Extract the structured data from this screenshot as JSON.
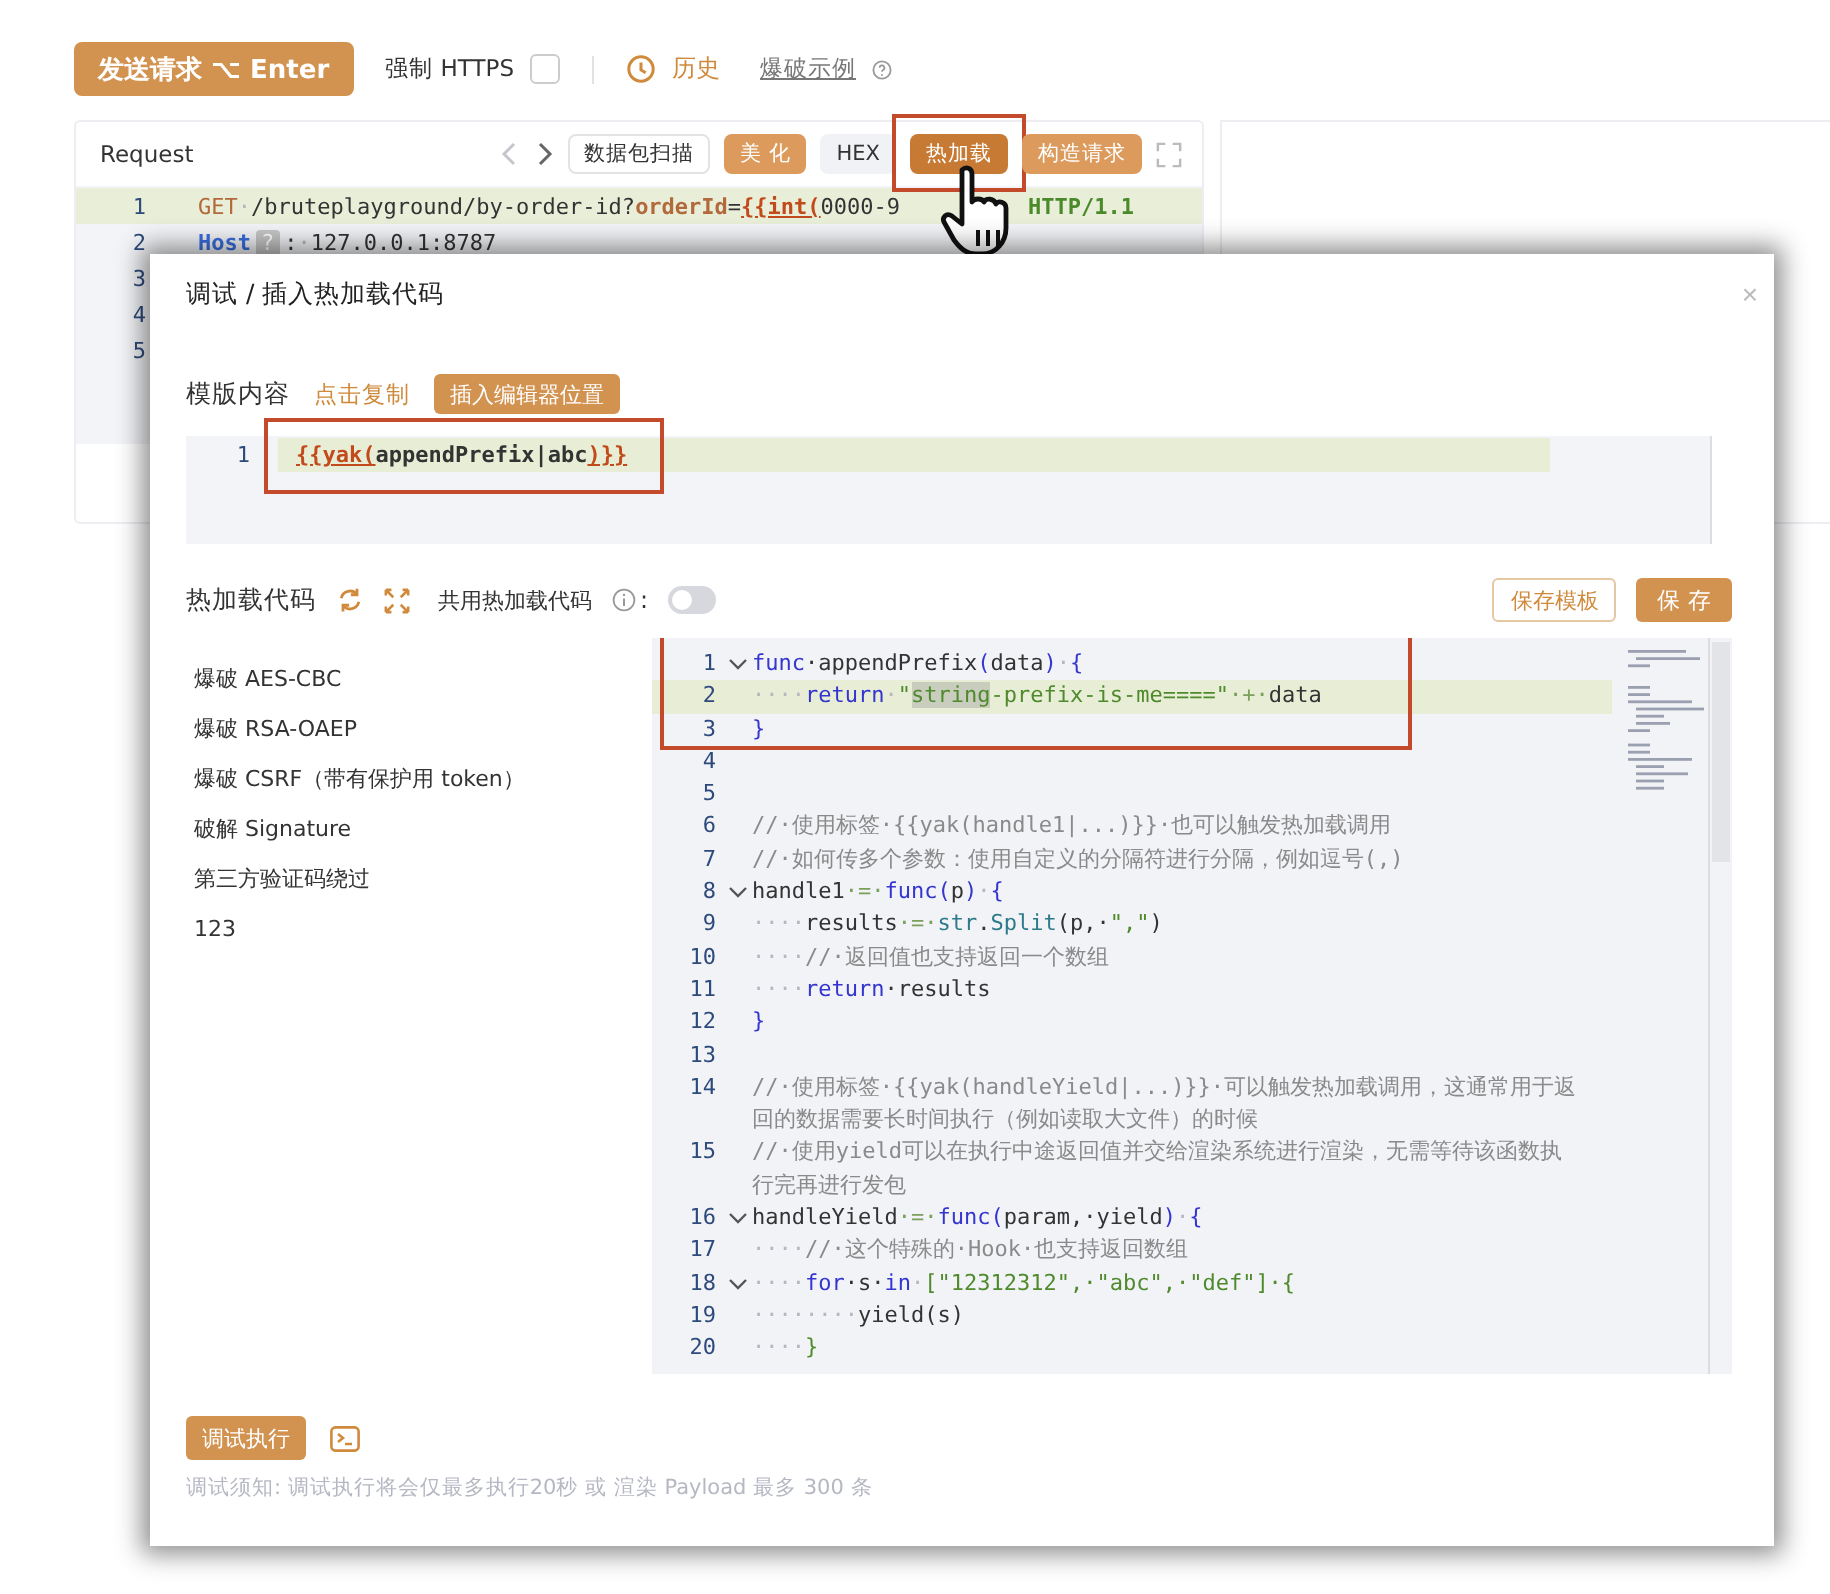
{
  "toolbar": {
    "send_button": "发送请求 ⌥ Enter",
    "force_https": {
      "label": "强制 HTTPS",
      "checked": false
    },
    "history": "历史",
    "examples_link": "爆破示例"
  },
  "request": {
    "title": "Request",
    "buttons": [
      {
        "label": "数据包扫描",
        "kind": "outline",
        "highlighted": false
      },
      {
        "label": "美 化",
        "kind": "primary",
        "highlighted": false
      },
      {
        "label": "HEX",
        "kind": "plain",
        "highlighted": false
      },
      {
        "label": "热加载",
        "kind": "primary",
        "highlighted": true
      },
      {
        "label": "构造请求",
        "kind": "primary",
        "highlighted": false
      }
    ],
    "lines": [
      {
        "number": "1",
        "active": true,
        "tokens": [
          {
            "kind": "method",
            "text": "GET"
          },
          {
            "kind": "ws",
            "text": "·"
          },
          {
            "kind": "plain",
            "text": "/bruteplayground/by-order-id?"
          },
          {
            "kind": "param",
            "text": "orderId"
          },
          {
            "kind": "plain",
            "text": "="
          },
          {
            "kind": "tag",
            "text": "{{int("
          },
          {
            "kind": "plain",
            "text": "0000-9"
          },
          {
            "kind": "gap",
            "text": "HTTP/1.1"
          }
        ]
      },
      {
        "number": "2",
        "active": false,
        "tokens": [
          {
            "kind": "header",
            "text": "Host"
          },
          {
            "kind": "badge",
            "text": "?"
          },
          {
            "kind": "plain",
            "text": ":"
          },
          {
            "kind": "ws",
            "text": "·"
          },
          {
            "kind": "plain",
            "text": "127.0.0.1:8787"
          }
        ]
      },
      {
        "number": "3",
        "active": false
      },
      {
        "number": "4",
        "active": false
      },
      {
        "number": "5",
        "active": false
      }
    ]
  },
  "dialog": {
    "title": "调试 / 插入热加载代码",
    "close": "×",
    "template": {
      "label": "模版内容",
      "copy_link": "点击复制",
      "insert_button": "插入编辑器位置",
      "lines": [
        {
          "number": "1",
          "active": true,
          "tokens": [
            {
              "kind": "tag",
              "text": "{{yak("
            },
            {
              "kind": "bold",
              "text": "appendPrefix|abc"
            },
            {
              "kind": "tag",
              "text": ")}}"
            }
          ]
        }
      ]
    },
    "hotload": {
      "label": "热加载代码",
      "shared_label": "共用热加载代码",
      "colon": ":",
      "shared_on": false,
      "save_template": "保存模板",
      "save": "保 存"
    },
    "presets": [
      {
        "label": "爆破 AES-CBC"
      },
      {
        "label": "爆破 RSA-OAEP"
      },
      {
        "label": "爆破 CSRF（带有保护用 token）"
      },
      {
        "label": "破解 Signature"
      },
      {
        "label": "第三方验证码绕过"
      },
      {
        "label": "123"
      }
    ],
    "code": [
      {
        "number": "1",
        "fold": true,
        "active": false,
        "tokens": [
          {
            "kind": "kw",
            "text": "func"
          },
          {
            "kind": "plain",
            "text": "·appendPrefix"
          },
          {
            "kind": "punct",
            "text": "("
          },
          {
            "kind": "plain",
            "text": "data"
          },
          {
            "kind": "punct",
            "text": ")"
          },
          {
            "kind": "ws",
            "text": "·"
          },
          {
            "kind": "punct",
            "text": "{"
          }
        ]
      },
      {
        "number": "2",
        "fold": false,
        "active": true,
        "tokens": [
          {
            "kind": "ws",
            "text": "····"
          },
          {
            "kind": "kw",
            "text": "return"
          },
          {
            "kind": "ws",
            "text": "·"
          },
          {
            "kind": "str",
            "text": "\""
          },
          {
            "kind": "match",
            "text": "string"
          },
          {
            "kind": "str",
            "text": "-prefix-is-me====\""
          },
          {
            "kind": "op",
            "text": "·+·"
          },
          {
            "kind": "plain",
            "text": "data"
          }
        ]
      },
      {
        "number": "3",
        "fold": false,
        "active": false,
        "tokens": [
          {
            "kind": "punct",
            "text": "}"
          }
        ]
      },
      {
        "number": "4",
        "fold": false,
        "active": false
      },
      {
        "number": "5",
        "fold": false,
        "active": false
      },
      {
        "number": "6",
        "fold": false,
        "active": false,
        "tokens": [
          {
            "kind": "com",
            "text": "//·使用标签·{{yak(handle1|...)}}·也可以触发热加载调用"
          }
        ]
      },
      {
        "number": "7",
        "fold": false,
        "active": false,
        "tokens": [
          {
            "kind": "com",
            "text": "//·如何传多个参数：使用自定义的分隔符进行分隔，例如逗号(,)"
          }
        ]
      },
      {
        "number": "8",
        "fold": true,
        "active": false,
        "tokens": [
          {
            "kind": "plain",
            "text": "handle1"
          },
          {
            "kind": "op",
            "text": "·=·"
          },
          {
            "kind": "kw",
            "text": "func"
          },
          {
            "kind": "punct",
            "text": "("
          },
          {
            "kind": "plain",
            "text": "p"
          },
          {
            "kind": "punct",
            "text": ")"
          },
          {
            "kind": "ws",
            "text": "·"
          },
          {
            "kind": "punct",
            "text": "{"
          }
        ]
      },
      {
        "number": "9",
        "fold": false,
        "active": false,
        "tokens": [
          {
            "kind": "ws",
            "text": "····"
          },
          {
            "kind": "plain",
            "text": "results"
          },
          {
            "kind": "op",
            "text": "·=·"
          },
          {
            "kind": "fn",
            "text": "str"
          },
          {
            "kind": "plain",
            "text": "."
          },
          {
            "kind": "fn",
            "text": "Split"
          },
          {
            "kind": "plain",
            "text": "(p,·"
          },
          {
            "kind": "str",
            "text": "\",\""
          },
          {
            "kind": "plain",
            "text": ")"
          }
        ]
      },
      {
        "number": "10",
        "fold": false,
        "active": false,
        "tokens": [
          {
            "kind": "ws",
            "text": "····"
          },
          {
            "kind": "com",
            "text": "//·返回值也支持返回一个数组"
          }
        ]
      },
      {
        "number": "11",
        "fold": false,
        "active": false,
        "tokens": [
          {
            "kind": "ws",
            "text": "····"
          },
          {
            "kind": "kw",
            "text": "return"
          },
          {
            "kind": "plain",
            "text": "·results"
          }
        ]
      },
      {
        "number": "12",
        "fold": false,
        "active": false,
        "tokens": [
          {
            "kind": "punct",
            "text": "}"
          }
        ]
      },
      {
        "number": "13",
        "fold": false,
        "active": false
      },
      {
        "number": "14",
        "fold": false,
        "active": false,
        "tokens": [
          {
            "kind": "com",
            "text": "//·使用标签·{{yak(handleYield|...)}}·可以触发热加载调用，这通常用于返回的数据需要长时间执行（例如读取大文件）的时候"
          }
        ]
      },
      {
        "number": "15",
        "fold": false,
        "active": false,
        "tokens": [
          {
            "kind": "com",
            "text": "//·使用yield可以在执行中途返回值并交给渲染系统进行渲染，无需等待该函数执行完再进行发包"
          }
        ]
      },
      {
        "number": "16",
        "fold": true,
        "active": false,
        "tokens": [
          {
            "kind": "plain",
            "text": "handleYield"
          },
          {
            "kind": "op",
            "text": "·=·"
          },
          {
            "kind": "kw",
            "text": "func"
          },
          {
            "kind": "punct",
            "text": "("
          },
          {
            "kind": "plain",
            "text": "param,·yield"
          },
          {
            "kind": "punct",
            "text": ")"
          },
          {
            "kind": "ws",
            "text": "·"
          },
          {
            "kind": "punct",
            "text": "{"
          }
        ]
      },
      {
        "number": "17",
        "fold": false,
        "active": false,
        "tokens": [
          {
            "kind": "ws",
            "text": "····"
          },
          {
            "kind": "com",
            "text": "//·这个特殊的·Hook·也支持返回数组"
          }
        ]
      },
      {
        "number": "18",
        "fold": true,
        "active": false,
        "tokens": [
          {
            "kind": "ws",
            "text": "····"
          },
          {
            "kind": "kw",
            "text": "for"
          },
          {
            "kind": "plain",
            "text": "·s·"
          },
          {
            "kind": "kw",
            "text": "in"
          },
          {
            "kind": "ws",
            "text": "·"
          },
          {
            "kind": "str",
            "text": "[\"12312312\",·\"abc\",·\"def\"]·{"
          }
        ]
      },
      {
        "number": "19",
        "fold": false,
        "active": false,
        "tokens": [
          {
            "kind": "ws",
            "text": "········"
          },
          {
            "kind": "plain",
            "text": "yield(s)"
          }
        ]
      },
      {
        "number": "20",
        "fold": false,
        "active": false,
        "tokens": [
          {
            "kind": "ws",
            "text": "····"
          },
          {
            "kind": "str",
            "text": "}"
          }
        ]
      }
    ],
    "run_button": "调试执行",
    "note": "调试须知: 调试执行将会仅最多执行20秒 或 渲染 Payload 最多 300 条"
  }
}
